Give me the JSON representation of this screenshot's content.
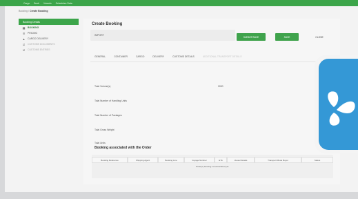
{
  "topbar": {
    "items": [
      "Cargo",
      "Book",
      "Vessels",
      "Schedules Data"
    ]
  },
  "breadcrumb": {
    "parent": "Booking",
    "current": "Create Booking"
  },
  "sidebar": {
    "header": "Booking Details",
    "items": [
      {
        "label": "BOOKING",
        "icon": "document-icon",
        "state": "active"
      },
      {
        "label": "PRICING",
        "icon": "list-icon",
        "state": "normal"
      },
      {
        "label": "CARGO DELIVERY",
        "icon": "warning-icon",
        "state": "normal"
      },
      {
        "label": "CUSTOMS DOCUMENTS",
        "icon": "check-icon",
        "state": "dim"
      },
      {
        "label": "CUSTOMS ENTRIES",
        "icon": "check-icon",
        "state": "dim"
      }
    ]
  },
  "main": {
    "title": "Create Booking",
    "type_value": "IMPORT",
    "buttons": {
      "primary": "SUBMIT/SAVE",
      "secondary": "SAVE",
      "close": "CLOSE"
    },
    "tabs": [
      "GENERAL",
      "CONTAINER",
      "CARGO",
      "DELIVERY",
      "CUSTOMS DETAILS",
      "ADDITIONAL TRANSPORT DETAILS"
    ],
    "fields": [
      {
        "label": "Total Volume(s)",
        "value": "0000"
      },
      {
        "label": "Total Number of Handling Units",
        "value": ""
      },
      {
        "label": "Total Number of Packages",
        "value": ""
      },
      {
        "label": "Total Gross Weight",
        "value": ""
      },
      {
        "label": "Total Units",
        "value": ""
      }
    ],
    "section_title": "Booking associated with the Order",
    "table": {
      "headers": [
        "Booking Reference",
        "Shipping Agent",
        "Booking Line",
        "Voyage Number",
        "ETA",
        "Vessel Details",
        "Transport Mode Buyer",
        "Status"
      ],
      "empty_message": "Order(s) booking not associated yet."
    }
  },
  "colors": {
    "accent": "#3ca54a",
    "overlay_icon": "#3498d6"
  },
  "overlay_icon": "butterfly-logo-icon"
}
